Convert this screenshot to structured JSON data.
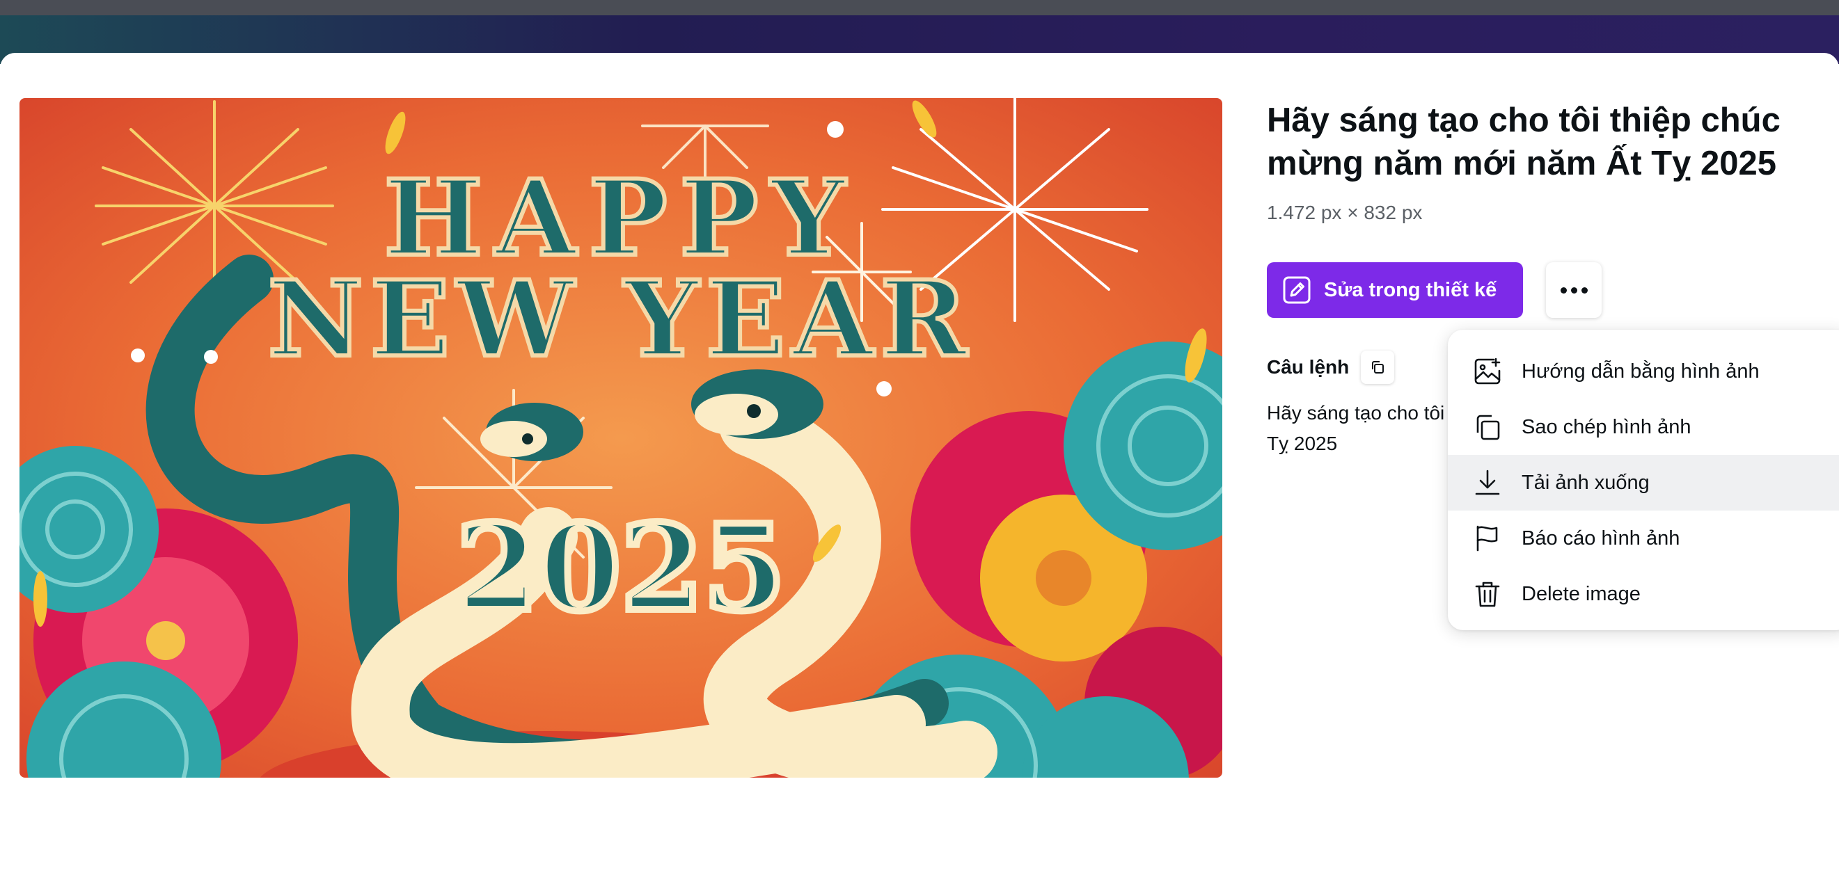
{
  "panel": {
    "title": "Hãy sáng tạo cho tôi thiệp chúc mừng năm mới năm Ất Tỵ 2025",
    "dimensions": "1.472 px × 832 px"
  },
  "image": {
    "headline_line1": "HAPPY",
    "headline_line2": "NEW YEAR",
    "year_text": "2025"
  },
  "actions": {
    "edit_label": "Sửa trong thiết kế",
    "edit_icon": "pencil-icon",
    "more_icon": "more-horizontal-icon"
  },
  "prompt": {
    "label": "Câu lệnh",
    "text": "Hãy sáng tạo cho tôi thiệp chúc mừng năm mới năm Ất Tỵ 2025"
  },
  "menu": {
    "items": [
      {
        "label": "Hướng dẫn bằng hình ảnh",
        "icon": "image-plus-icon"
      },
      {
        "label": "Sao chép hình ảnh",
        "icon": "copy-icon"
      },
      {
        "label": "Tải ảnh xuống",
        "icon": "download-icon",
        "hovered": true
      },
      {
        "label": "Báo cáo hình ảnh",
        "icon": "flag-icon"
      },
      {
        "label": "Delete image",
        "icon": "trash-icon"
      }
    ]
  },
  "colors": {
    "accent": "#7d2ae8",
    "text": "#0d1216",
    "muted": "#5b6066",
    "band": "#221d52"
  }
}
